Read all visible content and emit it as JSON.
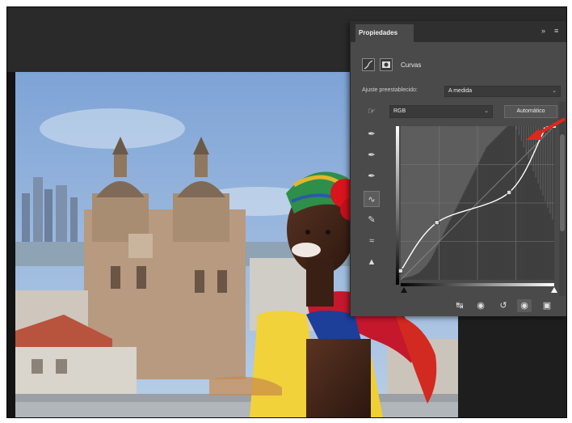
{
  "panel": {
    "tab_label": "Propiedades",
    "collapse_glyph": "»",
    "menu_glyph": "≡",
    "adjustment_name": "Curvas",
    "preset_label": "Ajuste preestablecido:",
    "preset_value": "A medida",
    "channel_value": "RGB",
    "auto_button": "Automático"
  },
  "icons": {
    "curves_adjustment": "curves-icon",
    "mask": "mask-icon",
    "targeted_adjust": "hand-icon",
    "eyedroppers": [
      "black-eyedropper-icon",
      "gray-eyedropper-icon",
      "white-eyedropper-icon"
    ],
    "curve_tool": "curve-icon",
    "pencil_tool": "pencil-icon",
    "smooth_tool": "smooth-icon",
    "clipping_warning": "warning-icon",
    "bottom": [
      "clip-to-layer-icon",
      "view-previous-icon",
      "reset-icon",
      "visibility-icon",
      "trash-icon"
    ]
  },
  "colors": {
    "panel_bg": "#4a4a4a",
    "panel_dark": "#2f2f2f",
    "curve_line": "#ffffff",
    "annotation_arrow": "#e0271c"
  },
  "curve": {
    "points": [
      [
        0,
        15
      ],
      [
        60,
        95
      ],
      [
        180,
        145
      ],
      [
        240,
        250
      ],
      [
        255,
        255
      ]
    ]
  },
  "histogram": [
    2,
    2,
    3,
    3,
    4,
    4,
    5,
    5,
    6,
    6,
    7,
    8,
    9,
    10,
    11,
    12,
    14,
    16,
    18,
    20,
    22,
    24,
    27,
    30,
    33,
    36,
    40,
    44,
    48,
    52,
    56,
    60,
    64,
    68,
    72,
    76,
    80,
    84,
    88,
    92,
    96,
    100,
    104,
    108,
    112,
    116,
    120,
    124,
    128,
    132,
    136,
    140,
    144,
    148,
    152,
    156,
    160,
    164,
    168,
    172,
    176,
    180,
    184,
    188,
    192,
    196,
    200,
    204,
    208,
    212,
    216,
    220,
    222,
    224,
    226,
    228,
    230,
    232,
    234,
    236,
    238,
    240,
    242,
    244,
    246,
    248,
    250,
    252,
    254,
    255,
    255,
    255,
    255,
    255,
    255,
    255,
    250,
    255,
    240,
    255,
    230,
    255,
    220,
    255,
    210,
    255,
    200,
    255,
    190,
    255,
    180,
    255,
    170,
    255,
    160,
    255,
    150,
    255,
    140,
    255,
    130,
    255,
    120,
    255,
    110,
    255,
    100,
    255
  ]
}
